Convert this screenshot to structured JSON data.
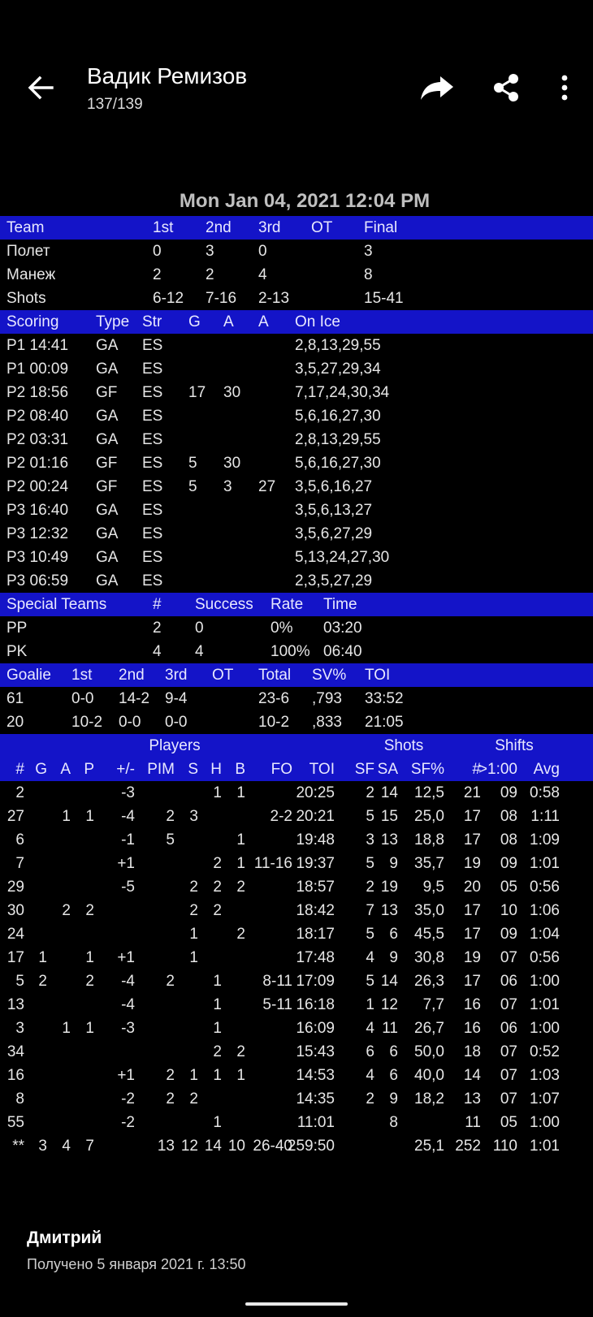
{
  "header": {
    "title": "Вадик Ремизов",
    "counter": "137/139",
    "icons": {
      "back": "arrow-left-icon",
      "forward": "forward-icon",
      "share": "share-icon",
      "more": "more-vertical-icon"
    }
  },
  "report": {
    "date": "Mon Jan 04, 2021 12:04 PM",
    "score_header": [
      "Team",
      "1st",
      "2nd",
      "3rd",
      "OT",
      "Final"
    ],
    "score_rows": [
      [
        "Полет",
        "0",
        "3",
        "0",
        "",
        "3"
      ],
      [
        "Манеж",
        "2",
        "2",
        "4",
        "",
        "8"
      ],
      [
        "Shots",
        "6-12",
        "7-16",
        "2-13",
        "",
        "15-41"
      ]
    ],
    "scoring_header": [
      "Scoring",
      "Type",
      "Str",
      "G",
      "A",
      "A",
      "On Ice"
    ],
    "scoring_rows": [
      [
        "P1 14:41",
        "GA",
        "ES",
        "",
        "",
        "",
        "2,8,13,29,55"
      ],
      [
        "P1 00:09",
        "GA",
        "ES",
        "",
        "",
        "",
        "3,5,27,29,34"
      ],
      [
        "P2 18:56",
        "GF",
        "ES",
        "17",
        "30",
        "",
        "7,17,24,30,34"
      ],
      [
        "P2 08:40",
        "GA",
        "ES",
        "",
        "",
        "",
        "5,6,16,27,30"
      ],
      [
        "P2 03:31",
        "GA",
        "ES",
        "",
        "",
        "",
        "2,8,13,29,55"
      ],
      [
        "P2 01:16",
        "GF",
        "ES",
        "5",
        "30",
        "",
        "5,6,16,27,30"
      ],
      [
        "P2 00:24",
        "GF",
        "ES",
        "5",
        "3",
        "27",
        "3,5,6,16,27"
      ],
      [
        "P3 16:40",
        "GA",
        "ES",
        "",
        "",
        "",
        "3,5,6,13,27"
      ],
      [
        "P3 12:32",
        "GA",
        "ES",
        "",
        "",
        "",
        "3,5,6,27,29"
      ],
      [
        "P3 10:49",
        "GA",
        "ES",
        "",
        "",
        "",
        "5,13,24,27,30"
      ],
      [
        "P3 06:59",
        "GA",
        "ES",
        "",
        "",
        "",
        "2,3,5,27,29"
      ]
    ],
    "special_header": [
      "Special Teams",
      "#",
      "Success",
      "Rate",
      "Time"
    ],
    "special_rows": [
      [
        "PP",
        "2",
        "0",
        "0%",
        "03:20"
      ],
      [
        "PK",
        "4",
        "4",
        "100%",
        "06:40"
      ]
    ],
    "goalie_header": [
      "Goalie",
      "1st",
      "2nd",
      "3rd",
      "OT",
      "Total",
      "SV%",
      "TOI"
    ],
    "goalie_rows": [
      [
        "61",
        "0-0",
        "14-2",
        "9-4",
        "",
        "23-6",
        ",793",
        "33:52"
      ],
      [
        "20",
        "10-2",
        "0-0",
        "0-0",
        "",
        "10-2",
        ",833",
        "21:05"
      ]
    ],
    "player_groups": [
      "Players",
      "Shots",
      "Shifts"
    ],
    "player_header": [
      "#",
      "G",
      "A",
      "P",
      "+/-",
      "PIM",
      "S",
      "H",
      "B",
      "FO",
      "TOI",
      "SF",
      "SA",
      "SF%",
      "#",
      ">1:00",
      "Avg"
    ],
    "player_rows": [
      [
        "2",
        "",
        "",
        "",
        "-3",
        "",
        "",
        "1",
        "1",
        "",
        "20:25",
        "2",
        "14",
        "12,5",
        "21",
        "09",
        "0:58"
      ],
      [
        "27",
        "",
        "1",
        "1",
        "-4",
        "2",
        "3",
        "",
        "",
        "2-2",
        "20:21",
        "5",
        "15",
        "25,0",
        "17",
        "08",
        "1:11"
      ],
      [
        "6",
        "",
        "",
        "",
        "-1",
        "5",
        "",
        "",
        "1",
        "",
        "19:48",
        "3",
        "13",
        "18,8",
        "17",
        "08",
        "1:09"
      ],
      [
        "7",
        "",
        "",
        "",
        "+1",
        "",
        "",
        "2",
        "1",
        "11-16",
        "19:37",
        "5",
        "9",
        "35,7",
        "19",
        "09",
        "1:01"
      ],
      [
        "29",
        "",
        "",
        "",
        "-5",
        "",
        "2",
        "2",
        "2",
        "",
        "18:57",
        "2",
        "19",
        "9,5",
        "20",
        "05",
        "0:56"
      ],
      [
        "30",
        "",
        "2",
        "2",
        "",
        "",
        "2",
        "2",
        "",
        "",
        "18:42",
        "7",
        "13",
        "35,0",
        "17",
        "10",
        "1:06"
      ],
      [
        "24",
        "",
        "",
        "",
        "",
        "",
        "1",
        "",
        "2",
        "",
        "18:17",
        "5",
        "6",
        "45,5",
        "17",
        "09",
        "1:04"
      ],
      [
        "17",
        "1",
        "",
        "1",
        "+1",
        "",
        "1",
        "",
        "",
        "",
        "17:48",
        "4",
        "9",
        "30,8",
        "19",
        "07",
        "0:56"
      ],
      [
        "5",
        "2",
        "",
        "2",
        "-4",
        "2",
        "",
        "1",
        "",
        "8-11",
        "17:09",
        "5",
        "14",
        "26,3",
        "17",
        "06",
        "1:00"
      ],
      [
        "13",
        "",
        "",
        "",
        "-4",
        "",
        "",
        "1",
        "",
        "5-11",
        "16:18",
        "1",
        "12",
        "7,7",
        "16",
        "07",
        "1:01"
      ],
      [
        "3",
        "",
        "1",
        "1",
        "-3",
        "",
        "",
        "1",
        "",
        "",
        "16:09",
        "4",
        "11",
        "26,7",
        "16",
        "06",
        "1:00"
      ],
      [
        "34",
        "",
        "",
        "",
        "",
        "",
        "",
        "2",
        "2",
        "",
        "15:43",
        "6",
        "6",
        "50,0",
        "18",
        "07",
        "0:52"
      ],
      [
        "16",
        "",
        "",
        "",
        "+1",
        "2",
        "1",
        "1",
        "1",
        "",
        "14:53",
        "4",
        "6",
        "40,0",
        "14",
        "07",
        "1:03"
      ],
      [
        "8",
        "",
        "",
        "",
        "-2",
        "2",
        "2",
        "",
        "",
        "",
        "14:35",
        "2",
        "9",
        "18,2",
        "13",
        "07",
        "1:07"
      ],
      [
        "55",
        "",
        "",
        "",
        "-2",
        "",
        "",
        "1",
        "",
        "",
        "11:01",
        "",
        "8",
        "",
        "11",
        "05",
        "1:00"
      ],
      [
        "**",
        "3",
        "4",
        "7",
        "",
        "13",
        "12",
        "14",
        "10",
        "26-40",
        "259:50",
        "",
        "",
        "25,1",
        "252",
        "110",
        "1:01"
      ]
    ]
  },
  "footer": {
    "sender": "Дмитрий",
    "received": "Получено 5 января 2021 г. 13:50"
  }
}
